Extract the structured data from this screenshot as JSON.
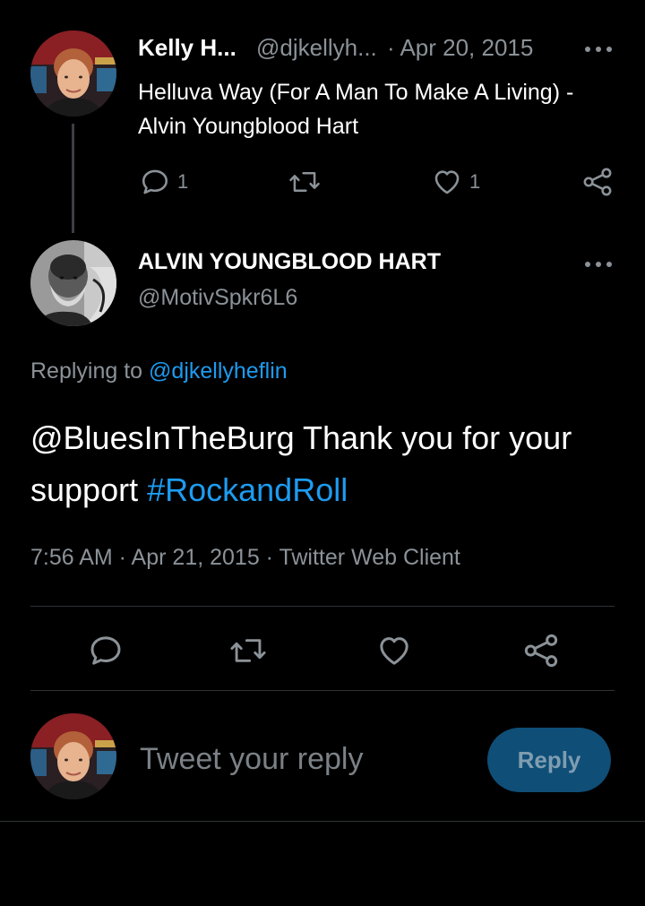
{
  "parent_tweet": {
    "author_name": "Kelly H...",
    "author_handle": "@djkellyh...",
    "date": "· Apr 20, 2015",
    "text": "Helluva Way (For A Man To Make A Living) - Alvin Youngblood Hart",
    "reply_count": "1",
    "like_count": "1"
  },
  "main_tweet": {
    "author_name": "ALVIN YOUNGBLOOD HART",
    "author_handle": "@MotivSpkr6L6",
    "replying_prefix": "Replying to",
    "replying_to": "@djkellyheflin",
    "text_body": "@BluesInTheBurg Thank you for your support",
    "hashtag": "#RockandRoll",
    "timestamp": "7:56 AM · Apr 21, 2015 · Twitter Web Client"
  },
  "composer": {
    "placeholder": "Tweet your reply",
    "reply_label": "Reply"
  },
  "icons": {
    "reply": "reply-icon",
    "retweet": "retweet-icon",
    "like": "heart-icon",
    "share": "share-icon",
    "more": "more-icon"
  },
  "colors": {
    "background": "#000000",
    "accent": "#1d9bf0",
    "muted_text": "#8b9298",
    "reply_button": "#0f4e77"
  }
}
